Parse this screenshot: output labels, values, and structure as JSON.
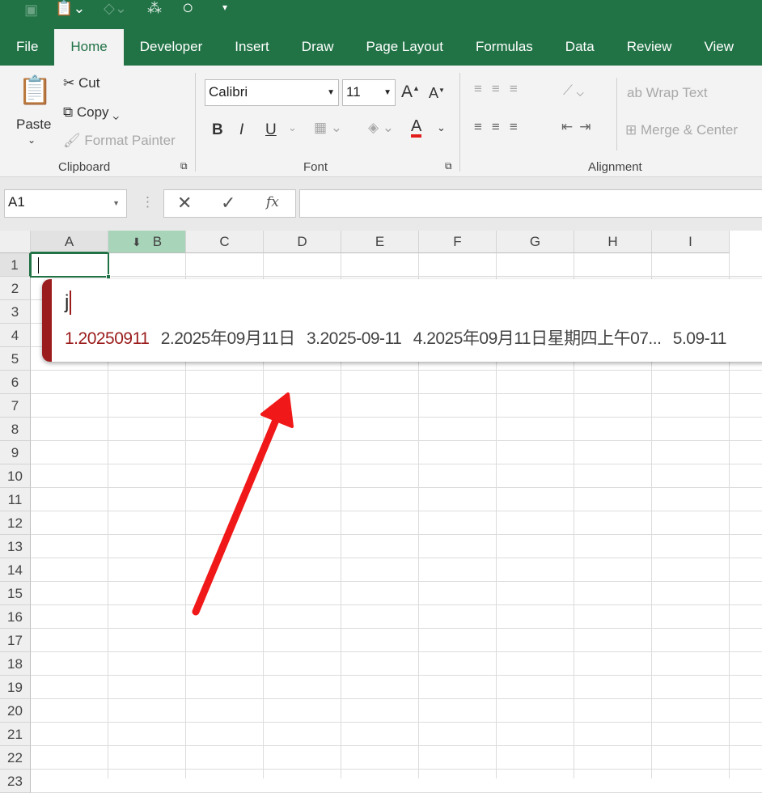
{
  "qat": {
    "icons": [
      "number-format-icon",
      "paste-icon",
      "fill-icon",
      "org-chart-icon",
      "circle-icon",
      "customize-icon"
    ]
  },
  "tabs": [
    "File",
    "Home",
    "Developer",
    "Insert",
    "Draw",
    "Page Layout",
    "Formulas",
    "Data",
    "Review",
    "View"
  ],
  "clipboard": {
    "paste": "Paste",
    "cut": "Cut",
    "copy": "Copy",
    "format_painter": "Format Painter",
    "group": "Clipboard"
  },
  "font": {
    "name": "Calibri",
    "size": "11",
    "bold": "B",
    "italic": "I",
    "underline": "U",
    "group": "Font"
  },
  "alignment": {
    "wrap": "Wrap Text",
    "merge": "Merge & Center",
    "group": "Alignment"
  },
  "formula_bar": {
    "name_box": "A1",
    "fx": "fx",
    "value": ""
  },
  "columns": [
    "A",
    "B",
    "C",
    "D",
    "E",
    "F",
    "G",
    "H",
    "I"
  ],
  "rows": [
    "1",
    "2",
    "3",
    "4",
    "5",
    "6",
    "7",
    "8",
    "9",
    "10",
    "11",
    "12",
    "13",
    "14",
    "15",
    "16",
    "17",
    "18",
    "19",
    "20",
    "21",
    "22",
    "23"
  ],
  "ime": {
    "input": "j",
    "candidates": [
      "1.20250911",
      "2.2025年09月11日",
      "3.2025-09-11",
      "4.2025年09月11日星期四上午07...",
      "5.09-11"
    ],
    "accent": "#9b1c1c"
  },
  "colors": {
    "brand": "#217346",
    "arrow": "#f01818"
  }
}
